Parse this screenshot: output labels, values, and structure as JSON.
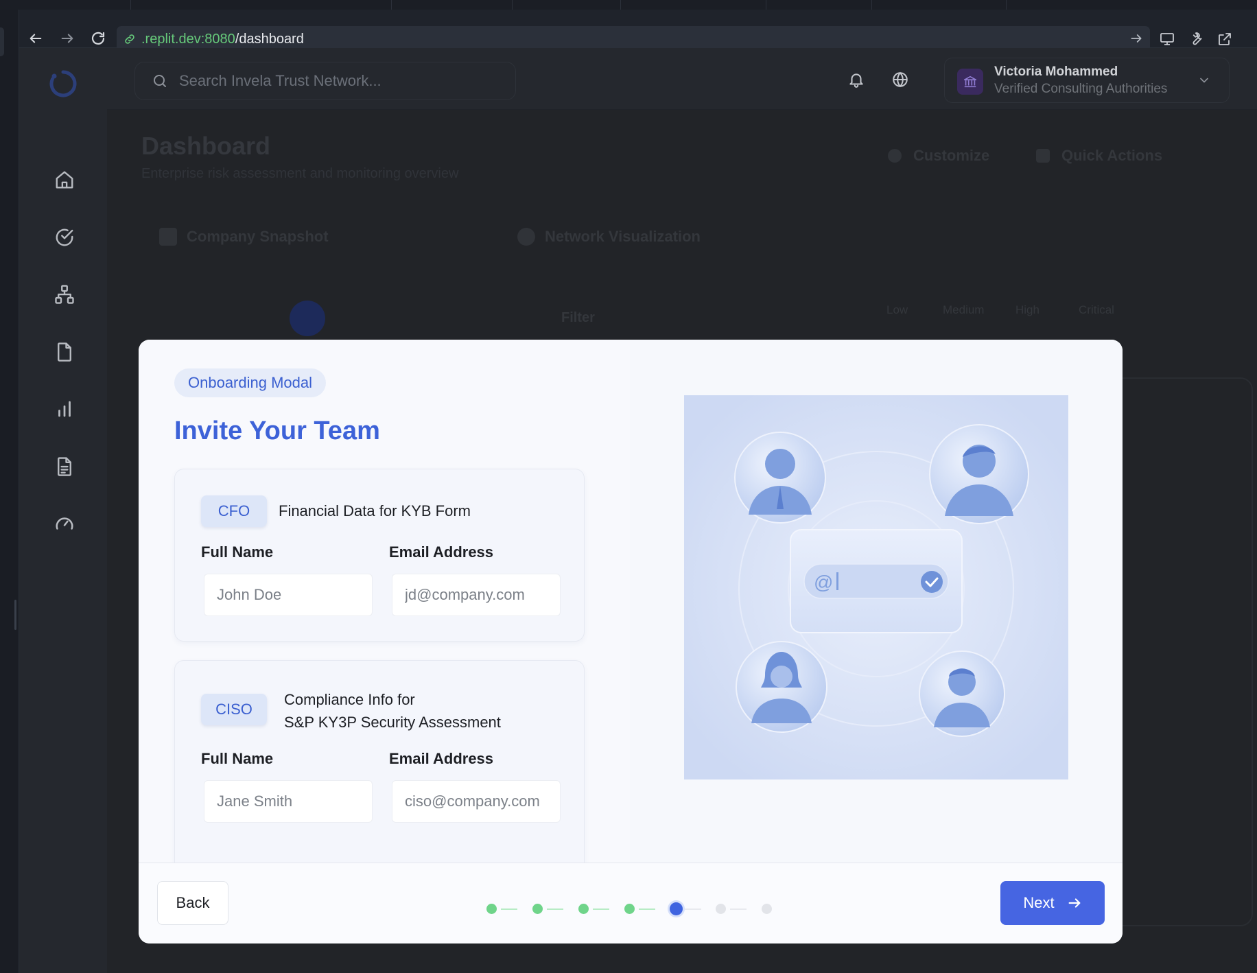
{
  "browser": {
    "url_host": ".replit.dev:8080",
    "url_path": "/dashboard"
  },
  "app": {
    "search_placeholder": "Search Invela Trust Network...",
    "user_name": "Victoria Mohammed",
    "user_org": "Verified Consulting Authorities",
    "page_title": "Dashboard",
    "page_subtitle": "Enterprise risk assessment and monitoring overview",
    "customize_label": "Customize",
    "quick_actions_label": "Quick Actions",
    "widget_company_snapshot": "Company Snapshot",
    "widget_network_visualization": "Network Visualization",
    "filter_label": "Filter",
    "risk_legend": [
      "Low",
      "Medium",
      "High",
      "Critical"
    ]
  },
  "modal": {
    "badge": "Onboarding Modal",
    "title": "Invite Your Team",
    "roles": [
      {
        "role": "CFO",
        "description_line1": "Financial Data for KYB Form",
        "description_line2": "",
        "name_label": "Full Name",
        "name_placeholder": "John Doe",
        "email_label": "Email Address",
        "email_placeholder": "jd@company.com"
      },
      {
        "role": "CISO",
        "description_line1": "Compliance Info for",
        "description_line2": "S&P KY3P Security Assessment",
        "name_label": "Full Name",
        "name_placeholder": "Jane Smith",
        "email_label": "Email Address",
        "email_placeholder": "ciso@company.com"
      }
    ],
    "back_label": "Back",
    "next_label": "Next",
    "steps_total": 7,
    "current_step": 5,
    "colors": {
      "accent": "#4665e2",
      "step_done": "#6fd48a",
      "step_current": "#3f64e0",
      "step_pending": "#e2e4e9"
    }
  },
  "icons": {
    "nav_back": "arrow-left-icon",
    "nav_forward": "arrow-right-icon",
    "reload": "reload-icon",
    "link": "link-icon",
    "sidebar": [
      "home-icon",
      "check-circle-icon",
      "network-icon",
      "file-icon",
      "bar-chart-icon",
      "document-icon",
      "gauge-icon"
    ],
    "header": [
      "search-icon",
      "bell-icon",
      "globe-icon",
      "bank-icon",
      "chevron-down-icon"
    ]
  }
}
